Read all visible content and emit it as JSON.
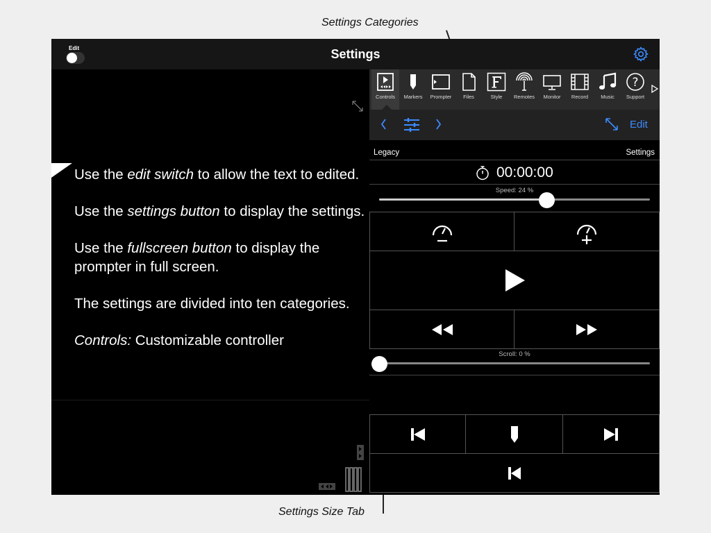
{
  "callouts": {
    "top": "Settings Categories",
    "bottom": "Settings Size Tab"
  },
  "topbar": {
    "edit_label": "Edit",
    "title": "Settings"
  },
  "prompter": {
    "paragraphs": [
      {
        "before": "Use the ",
        "em": "edit switch",
        "after": " to allow the text to edited."
      },
      {
        "before": "Use the ",
        "em": "settings button",
        "after": " to display the settings."
      },
      {
        "before": "Use the ",
        "em": "fullscreen button",
        "after": " to display the prompter in full screen."
      },
      {
        "before": "The settings are divided into ten categories.",
        "em": "",
        "after": ""
      },
      {
        "before": "",
        "em": "Controls:",
        "after": " Customizable controller"
      }
    ]
  },
  "categories": [
    "Controls",
    "Markers",
    "Prompter",
    "Files",
    "Style",
    "Remotes",
    "Monitor",
    "Record",
    "Music",
    "Support"
  ],
  "active_category": "Controls",
  "navbar": {
    "edit_label": "Edit"
  },
  "panel": {
    "legacy_label": "Legacy",
    "settings_label": "Settings",
    "timer": "00:00:00",
    "speed": {
      "label": "Speed: 24 %",
      "value": 24,
      "thumb_fraction": 0.62
    },
    "scroll": {
      "label": "Scroll: 0 %",
      "value": 0
    }
  },
  "colors": {
    "accent": "#3d8bff",
    "background": "#000000",
    "page": "#efefef"
  }
}
